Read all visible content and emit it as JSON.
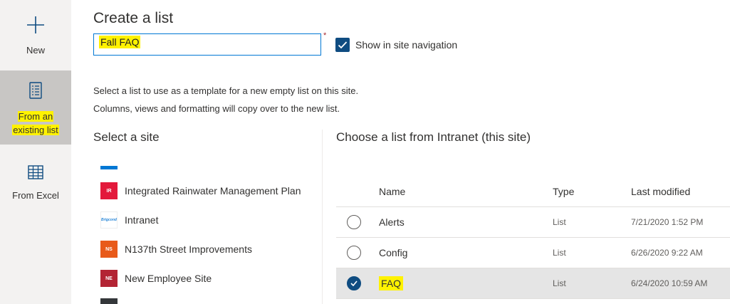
{
  "rail": {
    "new_label": "New",
    "existing_label_line1": "From an",
    "existing_label_line2": "existing list",
    "excel_label": "From Excel"
  },
  "header": {
    "title": "Create a list",
    "name_value": "Fall FAQ",
    "required_mark": "*",
    "show_in_nav_label": "Show in site navigation",
    "show_in_nav_checked": true
  },
  "description": {
    "line1": "Select a list to use as a template for a new empty list on this site.",
    "line2": "Columns, views and formatting will copy over to the new list."
  },
  "sites": {
    "heading": "Select a site",
    "items": [
      {
        "logo": "IR",
        "name": "Integrated Rainwater Management Plan",
        "color": "#e3193b"
      },
      {
        "logo": "Brigcond",
        "name": "Intranet",
        "color": "#2b88d8"
      },
      {
        "logo": "NS",
        "name": "N137th Street Improvements",
        "color": "#e85a1a"
      },
      {
        "logo": "NE",
        "name": "New Employee Site",
        "color": "#b32434"
      }
    ]
  },
  "lists": {
    "heading": "Choose a list from Intranet (this site)",
    "columns": {
      "name": "Name",
      "type": "Type",
      "modified": "Last modified"
    },
    "rows": [
      {
        "name": "Alerts",
        "type": "List",
        "modified": "7/21/2020 1:52 PM",
        "selected": false
      },
      {
        "name": "Config",
        "type": "List",
        "modified": "6/26/2020 9:22 AM",
        "selected": false
      },
      {
        "name": "FAQ",
        "type": "List",
        "modified": "6/24/2020 10:59 AM",
        "selected": true
      }
    ]
  },
  "colors": {
    "accent": "#0078d4",
    "checkbox": "#0f4c81",
    "highlight": "#fff200",
    "rail_bg": "#f3f2f1",
    "rail_selected": "#c8c6c4"
  }
}
